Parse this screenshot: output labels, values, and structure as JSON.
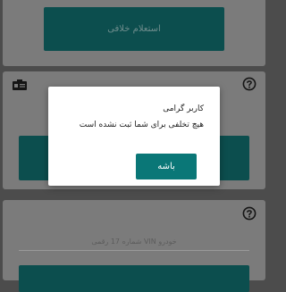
{
  "card1": {
    "button_label": "استعلام خلافی"
  },
  "card2": {
    "icon": "car-card-icon",
    "help_icon": "help-circle-icon"
  },
  "card3": {
    "help_icon": "help-circle-icon",
    "vin_placeholder": "شماره 17 رقمی VIN خودرو"
  },
  "dialog": {
    "title": "کاربر گرامی",
    "message": "هیچ تخلفی برای شما ثبت نشده است",
    "ok_label": "باشه"
  },
  "colors": {
    "overlay_bg": "#4c4c4c",
    "card_bg": "#7b7b7b",
    "teal_dark": "#0c4e4e",
    "teal_button": "#0a7777",
    "dialog_bg": "#ffffff"
  }
}
